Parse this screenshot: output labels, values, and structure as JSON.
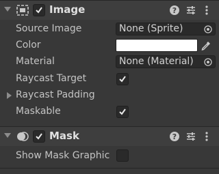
{
  "image_component": {
    "title": "Image",
    "enabled": true,
    "fields": {
      "source_image": {
        "label": "Source Image",
        "value": "None (Sprite)"
      },
      "color": {
        "label": "Color",
        "value": "#ffffff"
      },
      "material": {
        "label": "Material",
        "value": "None (Material)"
      },
      "raycast_target": {
        "label": "Raycast Target",
        "checked": true
      },
      "raycast_padding": {
        "label": "Raycast Padding"
      },
      "maskable": {
        "label": "Maskable",
        "checked": true
      }
    }
  },
  "mask_component": {
    "title": "Mask",
    "enabled": true,
    "fields": {
      "show_mask_graphic": {
        "label": "Show Mask Graphic",
        "checked": false
      }
    }
  },
  "icons": {
    "help": "help-icon",
    "presets": "presets-icon",
    "menu": "kebab-menu-icon",
    "picker": "object-picker-icon",
    "eyedropper": "eyedropper-icon"
  }
}
